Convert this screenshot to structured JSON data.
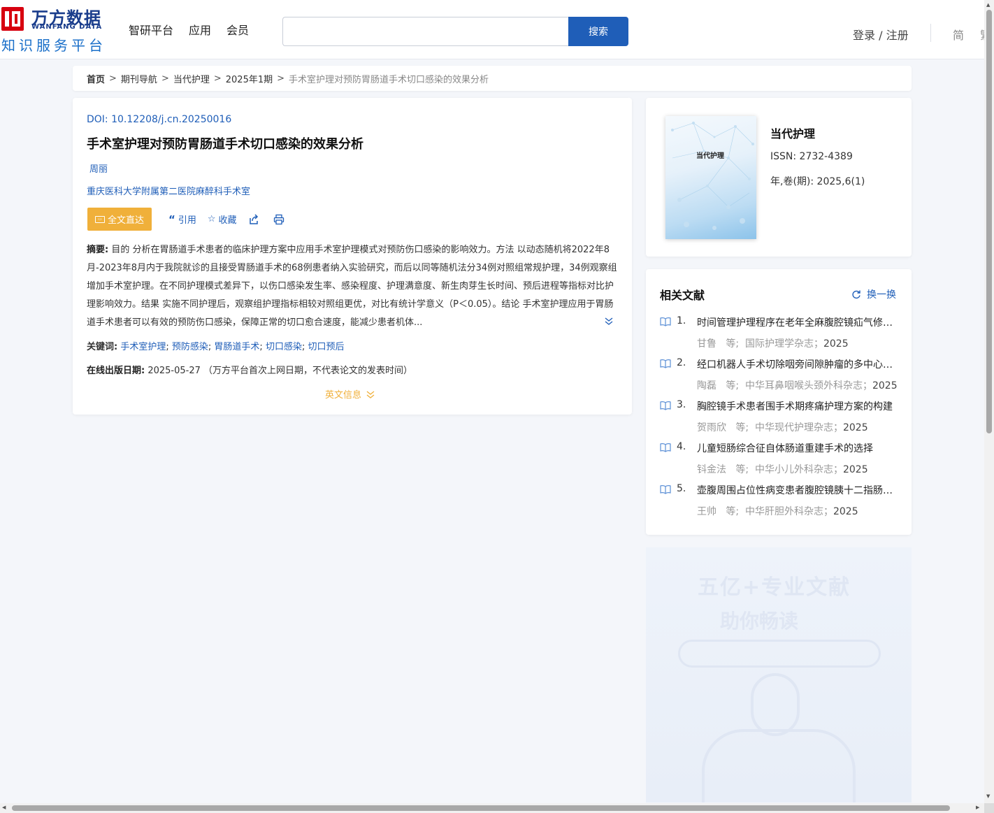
{
  "header": {
    "logo_cn": "万方数据",
    "logo_en": "WANFANG DATA",
    "logo_sub": "知识服务平台",
    "nav": [
      "智研平台",
      "应用",
      "会员"
    ],
    "search_placeholder": "",
    "search_button": "搜索",
    "login": "登录 / 注册",
    "lang": "简",
    "lang2": "繁"
  },
  "breadcrumb": {
    "items": [
      "首页",
      "期刊导航",
      "当代护理",
      "2025年1期"
    ],
    "current": "手术室护理对预防胃肠道手术切口感染的效果分析",
    "sep": ">"
  },
  "article": {
    "doi_label": "DOI:",
    "doi": "10.12208/j.cn.20250016",
    "title": "手术室护理对预防胃肠道手术切口感染的效果分析",
    "author": "周丽",
    "org": "重庆医科大学附属第二医院麻醉科手术室",
    "actions": {
      "fulltext": "全文直达",
      "cite": "引用",
      "favorite": "收藏"
    },
    "abstract_label": "摘要:",
    "abstract": "目的 分析在胃肠道手术患者的临床护理方案中应用手术室护理模式对预防伤口感染的影响效力。方法 以动态随机将2022年8月-2023年8月内于我院就诊的且接受胃肠道手术的68例患者纳入实验研究，而后以同等随机法分34例对照组常规护理，34例观察组增加手术室护理。在不同护理模式差异下，以伤口感染发生率、感染程度、护理满意度、新生肉芽生长时间、预后进程等指标对比护理影响效力。结果 实施不同护理后，观察组护理指标相较对照组更优，对比有统计学意义（P＜0.05）。结论 手术室护理应用于胃肠道手术患者可以有效的预防伤口感染，保障正常的切口愈合速度，能减少患者机体...",
    "keywords_label": "关键词:",
    "keywords": [
      "手术室护理",
      "预防感染",
      "胃肠道手术",
      "切口感染",
      "切口预后"
    ],
    "pubdate_label": "在线出版日期:",
    "pubdate": "2025-05-27",
    "pubdate_note": "（万方平台首次上网日期，不代表论文的发表时间）",
    "en_info": "英文信息"
  },
  "journal": {
    "name": "当代护理",
    "cover_text": "当代护理",
    "issn_label": "ISSN:",
    "issn": "2732-4389",
    "vol_label": "年,卷(期):",
    "vol": "2025,6(1)"
  },
  "related": {
    "title": "相关文献",
    "refresh": "换一换",
    "items": [
      {
        "num": "1.",
        "title": "时间管理护理程序在老年全麻腹腔镜疝气修补术中的应用",
        "author": "甘鲁",
        "etal": "等;",
        "journal": "国际护理学杂志；",
        "year": "2025"
      },
      {
        "num": "2.",
        "title": "经口机器人手术切除咽旁间隙肿瘤的多中心研究",
        "author": "陶磊",
        "etal": "等;",
        "journal": "中华耳鼻咽喉头颈外科杂志；",
        "year": "2025"
      },
      {
        "num": "3.",
        "title": "胸腔镜手术患者围手术期疼痛护理方案的构建",
        "author": "贺雨欣",
        "etal": "等;",
        "journal": "中华现代护理杂志；",
        "year": "2025"
      },
      {
        "num": "4.",
        "title": "儿童短肠综合征自体肠道重建手术的选择",
        "author": "钭金法",
        "etal": "等;",
        "journal": "中华小儿外科杂志；",
        "year": "2025"
      },
      {
        "num": "5.",
        "title": "壶腹周围占位性病变患者腹腔镜胰十二指肠切除术",
        "author": "王帅",
        "etal": "等;",
        "journal": "中华肝胆外科杂志；",
        "year": "2025"
      }
    ]
  },
  "ad": {
    "line1": "五亿+专业文献",
    "line2": "助你畅读"
  }
}
